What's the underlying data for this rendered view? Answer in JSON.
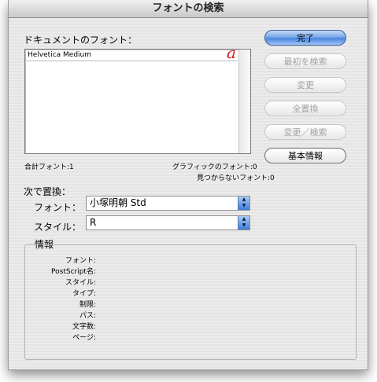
{
  "window": {
    "title": "フォントの検索"
  },
  "document_fonts": {
    "label": "ドキュメントのフォント：",
    "items": [
      {
        "name": "Helvetica Medium",
        "marker": "a"
      }
    ]
  },
  "stats": {
    "total": "合計フォント:1",
    "graphic": "グラフィックのフォント:0",
    "missing": "見つからないフォント:0"
  },
  "replace": {
    "heading": "次で置換：",
    "font_label": "フォント：",
    "font_value": "小塚明朝 Std",
    "style_label": "スタイル：",
    "style_value": "R"
  },
  "buttons": {
    "done": "完了",
    "find_first": "最初を検索",
    "change": "変更",
    "change_all": "全置換",
    "change_find": "変更／検索",
    "more_info": "基本情報"
  },
  "info": {
    "heading": "情報",
    "labels": [
      "フォント:",
      "PostScript名:",
      "スタイル:",
      "タイプ:",
      "制限:",
      "パス:",
      "文字数:",
      "ページ:"
    ]
  },
  "stepper_glyphs": {
    "up": "▲",
    "down": "▼"
  }
}
